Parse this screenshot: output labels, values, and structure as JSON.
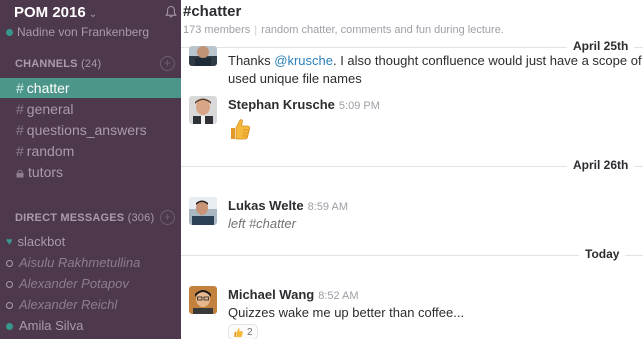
{
  "team": {
    "name": "POM 2016",
    "user": "Nadine von Frankenberg"
  },
  "channels_section": {
    "label": "CHANNELS",
    "count": "(24)"
  },
  "channels": [
    {
      "name": "chatter",
      "active": true,
      "private": false
    },
    {
      "name": "general",
      "active": false,
      "private": false
    },
    {
      "name": "questions_answers",
      "active": false,
      "private": false
    },
    {
      "name": "random",
      "active": false,
      "private": false
    },
    {
      "name": "tutors",
      "active": false,
      "private": true
    }
  ],
  "dm_section": {
    "label": "DIRECT MESSAGES",
    "count": "(306)"
  },
  "direct_messages": [
    {
      "name": "slackbot",
      "status": "bot",
      "italic": false
    },
    {
      "name": "Aisulu Rakhmetullina",
      "status": "away",
      "italic": true
    },
    {
      "name": "Alexander Potapov",
      "status": "away",
      "italic": true
    },
    {
      "name": "Alexander Reichl",
      "status": "away",
      "italic": true
    },
    {
      "name": "Amila Silva",
      "status": "active",
      "italic": false
    }
  ],
  "channel_header": {
    "title": "#chatter",
    "members": "173 members",
    "purpose": "random chatter, comments and fun during lecture."
  },
  "day_dividers": [
    "April 25th",
    "April 26th",
    "Today"
  ],
  "messages": [
    {
      "author": "",
      "time": "",
      "text_pre": "Thanks ",
      "mention": "@krusche",
      "text_post": ". I also thought confluence would just have a scope of",
      "text_line2": "used unique file names"
    },
    {
      "author": "Stephan Krusche",
      "time": "5:09 PM",
      "emoji": "thumbs-up"
    },
    {
      "author": "Lukas Welte",
      "time": "8:59 AM",
      "text": "left #chatter"
    },
    {
      "author": "Michael Wang",
      "time": "8:52 AM",
      "text": "Quizzes wake me up better than coffee...",
      "reaction_count": "2"
    }
  ],
  "colors": {
    "sidebar": "#4d394b",
    "active_channel": "#4c9689",
    "mention": "#2a80b9"
  }
}
